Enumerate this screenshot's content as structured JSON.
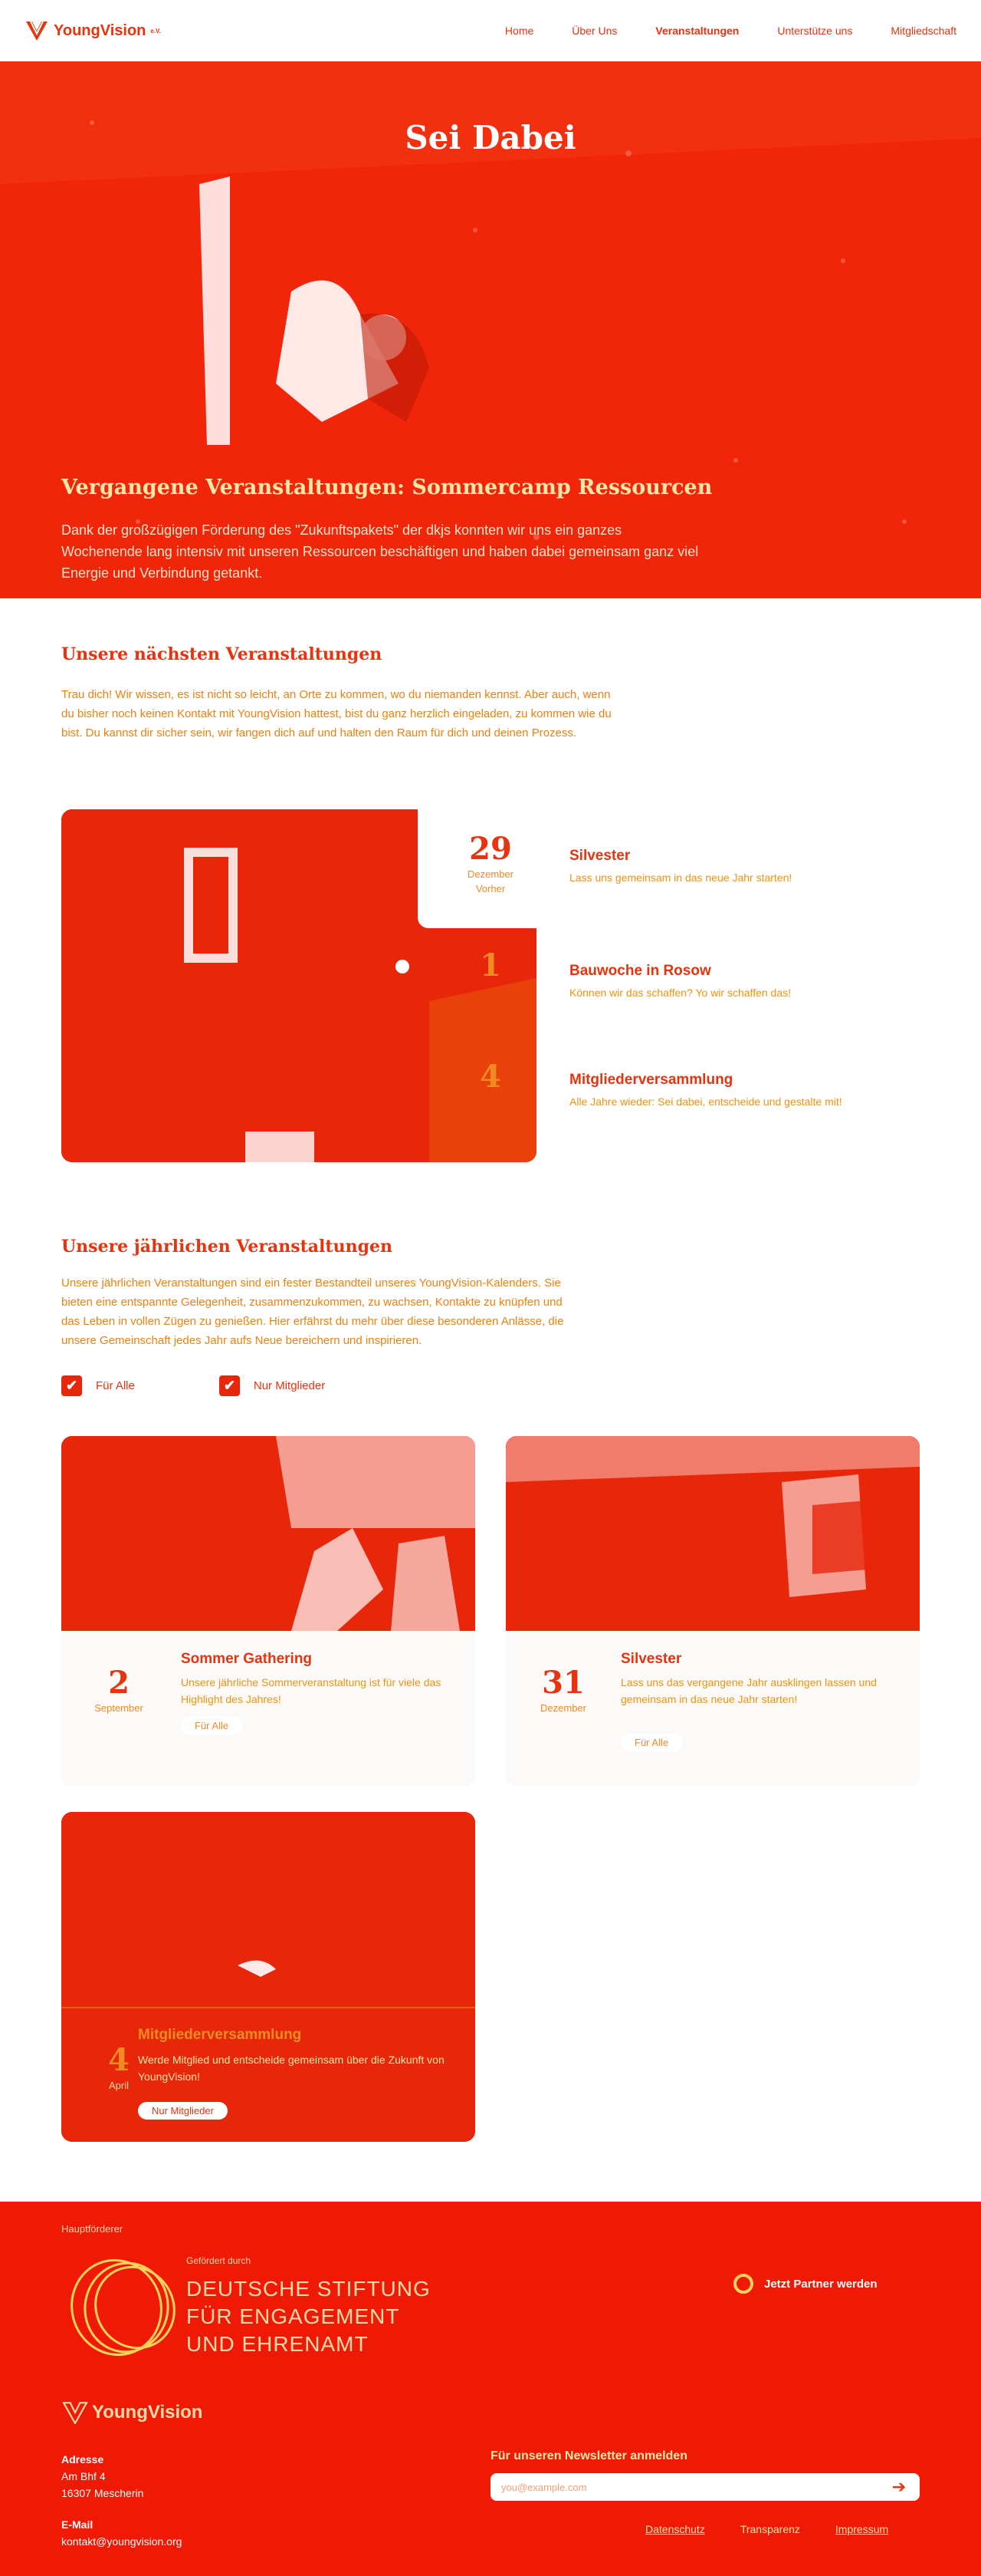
{
  "header": {
    "logo_text": "YoungVision",
    "logo_sup": "e.V.",
    "nav": [
      {
        "label": "Home"
      },
      {
        "label": "Über Uns"
      },
      {
        "label": "Veranstaltungen"
      },
      {
        "label": "Unterstütze uns"
      },
      {
        "label": "Mitgliedschaft"
      }
    ]
  },
  "hero": {
    "title": "Sei Dabei",
    "subtitle": "Vergangene Veranstaltungen: Sommercamp Ressourcen",
    "text": "Dank der großzügigen Förderung des \"Zukunftspakets\" der dkjs konnten wir uns ein ganzes Wochenende lang intensiv mit unseren Ressourcen beschäftigen und haben dabei gemeinsam ganz viel Energie und Verbindung getankt."
  },
  "next": {
    "title": "Unsere nächsten Veranstaltungen",
    "text": "Trau dich! Wir wissen, es ist nicht so leicht, an Orte zu kommen, wo du niemanden kennst. Aber auch, wenn du bisher noch keinen Kontakt mit YoungVision hattest, bist du ganz herzlich eingeladen, zu kommen wie du bist. Du kannst dir sicher sein, wir fangen dich auf und halten den Raum für dich und deinen Prozess.",
    "events": [
      {
        "day": "29",
        "month": "Dezember",
        "extra": "Vorher",
        "title": "Silvester",
        "desc": "Lass uns gemeinsam in das neue Jahr starten!"
      },
      {
        "day": "1",
        "month": "",
        "extra": "",
        "title": "Bauwoche in Rosow",
        "desc": "Können wir das schaffen? Yo wir schaffen das!"
      },
      {
        "day": "4",
        "month": "",
        "extra": "",
        "title": "Mitgliederversammlung",
        "desc": "Alle Jahre wieder: Sei dabei, entscheide und gestalte mit!"
      }
    ]
  },
  "yearly": {
    "title": "Unsere jährlichen Veranstaltungen",
    "text": "Unsere jährlichen Veranstaltungen sind ein fester Bestandteil unseres YoungVision-Kalenders. Sie bieten eine entspannte Gelegenheit, zusammenzukommen, zu wachsen, Kontakte zu knüpfen und das Leben in vollen Zügen zu genießen. Hier erfährst du mehr über diese besonderen Anlässe, die unsere Gemeinschaft jedes Jahr aufs Neue bereichern und inspirieren.",
    "filters": [
      {
        "label": "Für Alle",
        "checked": "✔"
      },
      {
        "label": "Nur Mitglieder",
        "checked": "✔"
      }
    ],
    "cards": [
      {
        "day": "2",
        "month": "September",
        "title": "Sommer Gathering",
        "desc": "Unsere jährliche Sommerveranstaltung ist für viele das Highlight des Jahres!",
        "tag": "Für Alle"
      },
      {
        "day": "31",
        "month": "Dezember",
        "title": "Silvester",
        "desc": "Lass uns das vergangene Jahr ausklingen lassen und gemeinsam in das neue Jahr starten!",
        "tag": "Für Alle"
      },
      {
        "day": "4",
        "month": "April",
        "title": "Mitgliederversammlung",
        "desc": "Werde Mitglied und entscheide gemeinsam über die Zukunft von YoungVision!",
        "tag": "Nur Mitglieder"
      }
    ]
  },
  "footer": {
    "sponsor_label": "Hauptförderer",
    "sponsor_small": "Gefördert durch",
    "sponsor_lines": [
      "DEUTSCHE STIFTUNG",
      "FÜR ENGAGEMENT",
      "UND EHRENAMT"
    ],
    "partner_button": "Jetzt Partner werden",
    "logo_text": "YoungVision",
    "address_label": "Adresse",
    "address_lines": [
      "Am Bhf 4",
      "16307 Mescherin"
    ],
    "email_label": "E-Mail",
    "email": "kontakt@youngvision.org",
    "newsletter_label": "Für unseren Newsletter anmelden",
    "newsletter_placeholder": "you@example.com",
    "links": [
      {
        "label": "Datenschutz"
      },
      {
        "label": "Transparenz"
      },
      {
        "label": "Impressum"
      }
    ]
  },
  "colors": {
    "primary": "#e8330f",
    "accent": "#f08a22",
    "footer_bg": "#ee1a06"
  }
}
